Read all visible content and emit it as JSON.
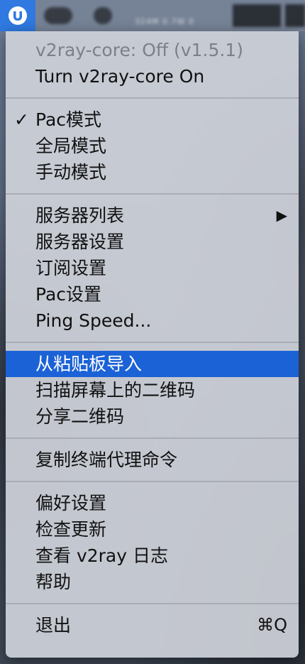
{
  "menubar": {
    "app_icon": "v2ray-u-logo-icon",
    "blurred_stats": "324M  0.7W  0"
  },
  "menu": {
    "status": "v2ray-core: Off  (v1.5.1)",
    "toggle_core": "Turn v2ray-core On",
    "mode_check_icon": "checkmark-icon",
    "mode_check": "✓",
    "mode_pac": "Pac模式",
    "mode_global": "全局模式",
    "mode_manual": "手动模式",
    "server_list": "服务器列表",
    "server_list_arrow": "▶",
    "server_settings": "服务器设置",
    "subscription_settings": "订阅设置",
    "pac_settings": "Pac设置",
    "ping_speed": "Ping Speed...",
    "import_clipboard": "从粘贴板导入",
    "scan_qrcode": "扫描屏幕上的二维码",
    "share_qrcode": "分享二维码",
    "copy_proxy_command": "复制终端代理命令",
    "preferences": "偏好设置",
    "check_updates": "检查更新",
    "view_log": "查看 v2ray 日志",
    "help": "帮助",
    "quit": "退出",
    "quit_shortcut": "⌘Q"
  }
}
